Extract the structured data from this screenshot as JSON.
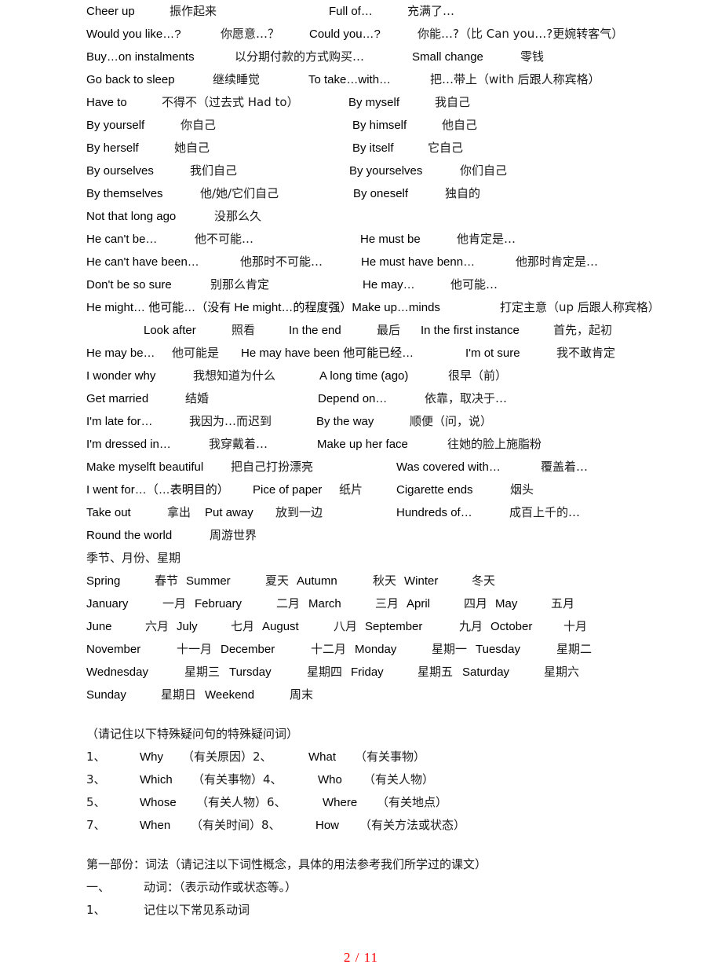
{
  "document": {
    "lines": [
      {
        "segments": [
          "Cheer up",
          "振作起来",
          "Full of…",
          "充满了…"
        ]
      },
      {
        "segments": [
          "Would you like…?",
          "你愿意…？",
          "Could you…?",
          "你能…?（比 Can you…?更婉转客气）"
        ]
      },
      {
        "segments": [
          "Buy…on instalments",
          "以分期付款的方式购买…",
          "Small change",
          "零钱"
        ]
      },
      {
        "segments": [
          "Go back to sleep",
          "继续睡觉",
          "To take…with…",
          "把…带上（with 后跟人称宾格）"
        ]
      },
      {
        "segments": [
          "Have to",
          "不得不（过去式 Had to）",
          "By myself",
          "我自己"
        ]
      },
      {
        "segments": [
          "By yourself",
          "你自己",
          "By himself",
          "他自己"
        ]
      },
      {
        "segments": [
          "By herself",
          "她自己",
          "By itself",
          "它自己"
        ]
      },
      {
        "segments": [
          "By ourselves",
          "我们自己",
          "By yourselves",
          "你们自己"
        ]
      },
      {
        "segments": [
          "By themselves",
          "他/她/它们自己",
          "By oneself",
          "独自的"
        ]
      },
      {
        "segments": [
          "Not that long ago",
          "没那么久"
        ]
      },
      {
        "segments": [
          "He can't be…",
          "他不可能…",
          "He must be",
          "他肯定是…"
        ]
      },
      {
        "segments": [
          "He can't have been…",
          "他那时不可能…",
          "He must have benn…",
          "他那时肯定是…"
        ]
      },
      {
        "segments": [
          "Don't be so sure",
          "别那么肯定",
          "He may…",
          "他可能…"
        ]
      },
      {
        "segments": [
          "He might… 他可能…（没有 He might…的程度强）Make up…minds",
          "打定主意（up 后跟人称宾格）"
        ]
      },
      {
        "segments": [
          "Look after",
          "照看",
          "In the end",
          "最后",
          "In the first instance",
          "首先，起初"
        ]
      },
      {
        "segments": [
          "He may be…",
          "他可能是",
          "He may have been 他可能已经…",
          "I'm ot sure",
          "我不敢肯定"
        ]
      },
      {
        "segments": [
          "I wonder why",
          "我想知道为什么",
          "A long time (ago)",
          "很早（前）"
        ]
      },
      {
        "segments": [
          "Get married",
          "结婚",
          "Depend on…",
          "依靠，取决于…"
        ]
      },
      {
        "segments": [
          "I'm late for…",
          "我因为…而迟到",
          "By the way",
          "顺便（问，说）"
        ]
      },
      {
        "segments": [
          "I'm dressed in…",
          "我穿戴着…",
          "Make up her face",
          "往她的脸上施脂粉"
        ]
      },
      {
        "segments": [
          "Make myselft beautiful",
          "把自己打扮漂亮",
          "Was covered with…",
          "覆盖着…"
        ]
      },
      {
        "segments": [
          "I went for…（…表明目的）",
          "Pice of paper",
          "纸片",
          "Cigarette ends",
          "烟头"
        ]
      },
      {
        "segments": [
          "Take out",
          "拿出",
          "Put away",
          "放到一边",
          "Hundreds of…",
          "成百上千的…"
        ]
      },
      {
        "segments": [
          "Round the world",
          "周游世界"
        ]
      },
      {
        "segments": [
          "季节、月份、星期"
        ]
      },
      {
        "segments": [
          "Spring",
          "春节",
          "Summer",
          "夏天",
          "Autumn",
          "秋天",
          "Winter",
          "冬天"
        ]
      },
      {
        "segments": [
          "January",
          "一月",
          "February",
          "二月",
          "March",
          "三月",
          "April",
          "四月",
          "May",
          "五月"
        ]
      },
      {
        "segments": [
          "June",
          "六月",
          "July",
          "七月",
          "August",
          "八月",
          "September",
          "九月",
          "October",
          "十月"
        ]
      },
      {
        "segments": [
          "November",
          "十一月",
          "December",
          "十二月",
          "Monday",
          "星期一",
          "Tuesday",
          "星期二"
        ]
      },
      {
        "segments": [
          "Wednesday",
          "星期三",
          "Tursday",
          "星期四",
          "Friday",
          "星期五",
          "Saturday",
          "星期六"
        ]
      },
      {
        "segments": [
          "Sunday",
          "星期日",
          "Weekend",
          "周末"
        ]
      },
      {
        "segments": [
          "（请记住以下特殊疑问句的特殊疑问词）"
        ]
      },
      {
        "segments": [
          "1、",
          "Why",
          "（有关原因）2、",
          "What",
          "（有关事物）"
        ]
      },
      {
        "segments": [
          "3、",
          "Which",
          "（有关事物）4、",
          "Who",
          "（有关人物）"
        ]
      },
      {
        "segments": [
          "5、",
          "Whose",
          "（有关人物）6、",
          "Where",
          "（有关地点）"
        ]
      },
      {
        "segments": [
          "7、",
          "When",
          "（有关时间）8、",
          "How",
          "（有关方法或状态）"
        ]
      },
      {
        "segments": [
          "第一部份：词法（请记注以下词性概念，具体的用法参考我们所学过的课文）"
        ]
      },
      {
        "segments": [
          "一、",
          "动词：（表示动作或状态等。）"
        ]
      },
      {
        "segments": [
          "1、",
          "记住以下常见系动词"
        ]
      }
    ]
  },
  "footer": {
    "page_indicator": "2 / 11",
    "color": "#ff0000"
  }
}
